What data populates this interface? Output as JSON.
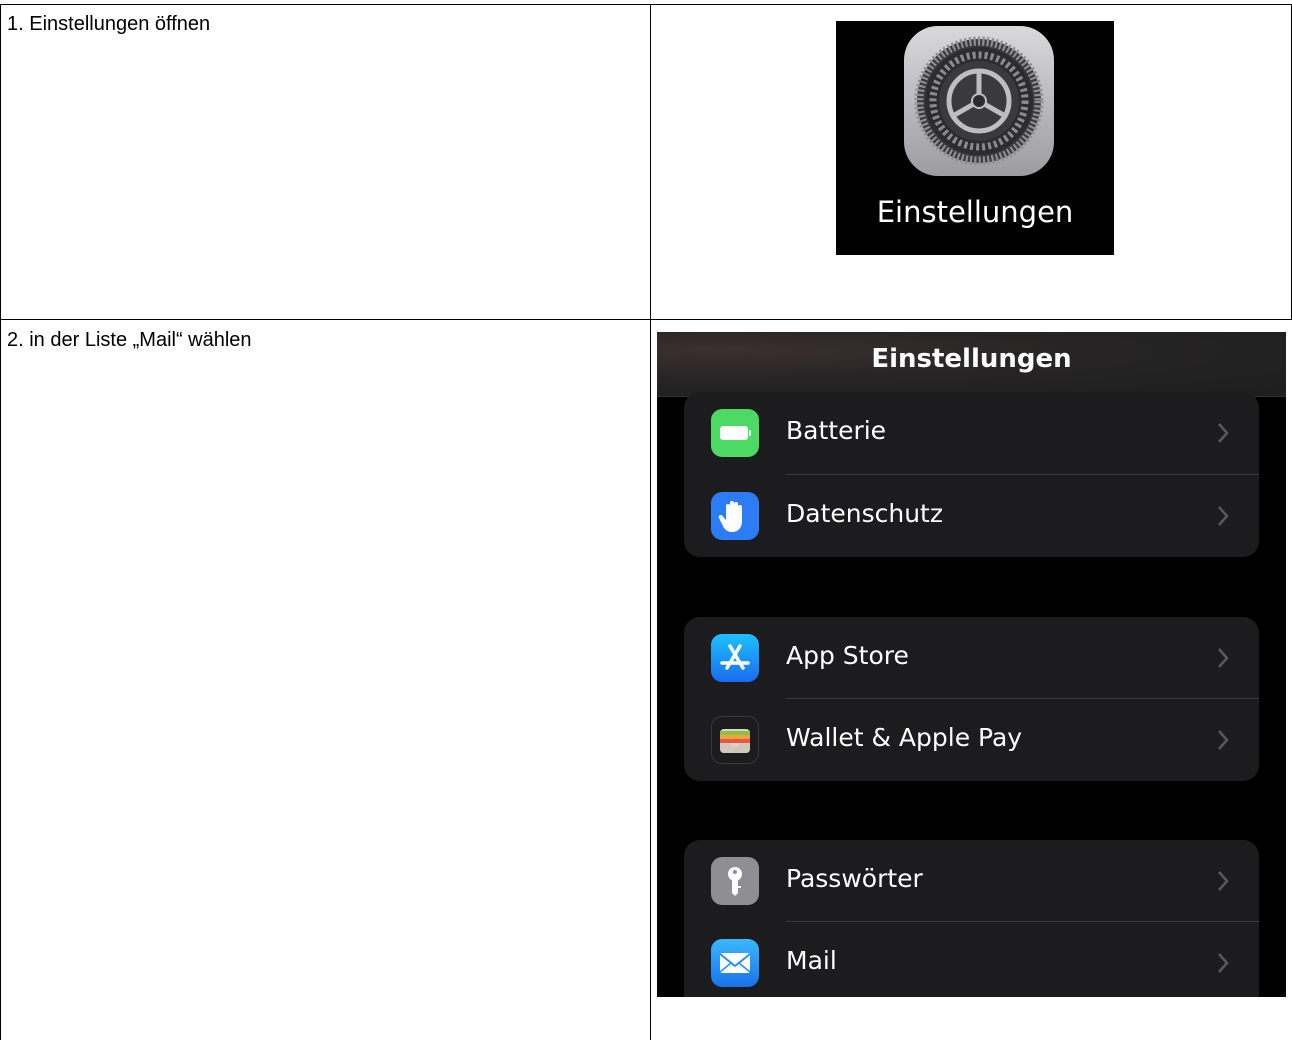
{
  "steps": [
    {
      "text": "1. Einstellungen öffnen"
    },
    {
      "text": "2. in der Liste „Mail“ wählen"
    }
  ],
  "app_icon": {
    "label": "Einstellungen",
    "icon": "gear-icon"
  },
  "settings_screen": {
    "title": "Einstellungen",
    "groups": [
      {
        "rows": [
          {
            "label": "Batterie",
            "icon": "battery-icon",
            "color": "#4cd964"
          },
          {
            "label": "Datenschutz",
            "icon": "hand-icon",
            "color": "#2c7cf6"
          }
        ]
      },
      {
        "rows": [
          {
            "label": "App Store",
            "icon": "app-store-icon",
            "color": "#1a8cff"
          },
          {
            "label": "Wallet & Apple Pay",
            "icon": "wallet-icon",
            "color": "#1c1c1e"
          }
        ]
      },
      {
        "rows": [
          {
            "label": "Passwörter",
            "icon": "key-icon",
            "color": "#8e8e93"
          },
          {
            "label": "Mail",
            "icon": "mail-icon",
            "color": "#2f9bf5"
          }
        ]
      }
    ]
  }
}
